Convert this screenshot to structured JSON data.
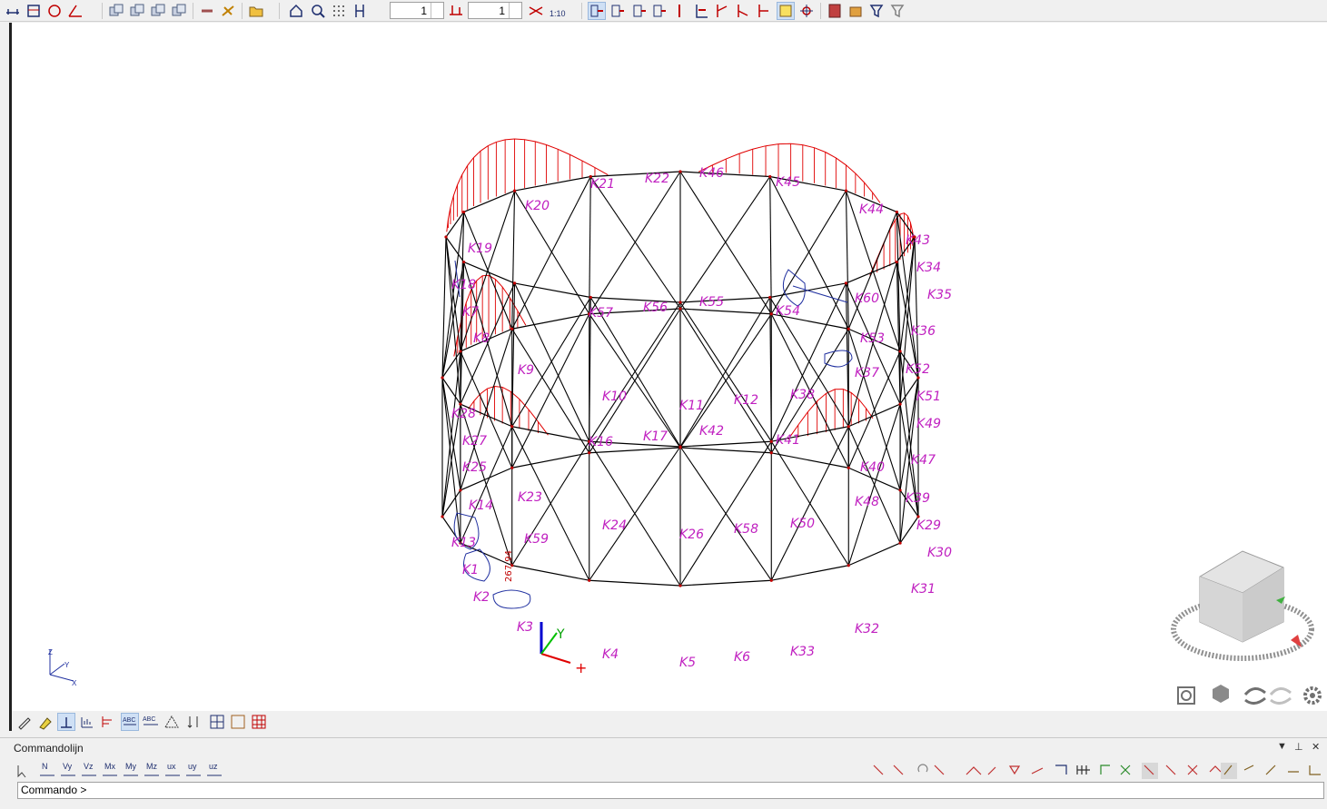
{
  "toolbar": {
    "spin1_value": "1",
    "spin2_value": "1",
    "scale_label": "1:10",
    "icons": [
      "snap-grid-icon",
      "window-icon",
      "circle-icon",
      "angle-icon",
      "copy-icon",
      "paste-icon",
      "move-icon",
      "rotate-icon",
      "mirror-icon",
      "folder-icon",
      "zoom-icon",
      "search-icon",
      "dots-icon",
      "dimension-icon",
      "select-icon",
      "node-icon",
      "member-icon",
      "support-icon",
      "load-icon",
      "results-icon",
      "settings-icon"
    ]
  },
  "model": {
    "node_labels": [
      "K1",
      "K2",
      "K3",
      "K4",
      "K5",
      "K6",
      "K7",
      "K8",
      "K9",
      "K10",
      "K11",
      "K12",
      "K13",
      "K14",
      "K16",
      "K17",
      "K18",
      "K19",
      "K20",
      "K21",
      "K22",
      "K23",
      "K24",
      "K25",
      "K26",
      "K27",
      "K28",
      "K29",
      "K30",
      "K31",
      "K32",
      "K33",
      "K34",
      "K35",
      "K36",
      "K37",
      "K38",
      "K39",
      "K40",
      "K41",
      "K42",
      "K43",
      "K44",
      "K45",
      "K46",
      "K47",
      "K48",
      "K49",
      "K50",
      "K51",
      "K52",
      "K53",
      "K54",
      "K55",
      "K56",
      "K57",
      "K58",
      "K59",
      "K60"
    ],
    "value_label": "267.94",
    "axis_labels": {
      "x": "X",
      "y": "Y",
      "z": "Z"
    }
  },
  "command_panel": {
    "title": "Commandolijn",
    "prompt": "Commando >",
    "tools": [
      "N",
      "Vy",
      "Vz",
      "Mx",
      "My",
      "Mz",
      "ux",
      "uy",
      "uz"
    ]
  },
  "colors": {
    "node_label": "#c020c0",
    "member": "#000000",
    "diagram": "#e00000",
    "contour": "#2030a0"
  }
}
